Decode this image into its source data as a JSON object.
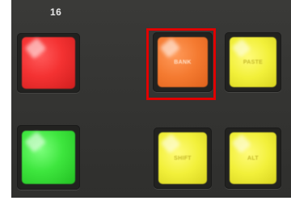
{
  "panel": {
    "channel_number": "16"
  },
  "keys": {
    "bank": {
      "label": "BANK",
      "color": "#f47a30"
    },
    "paste": {
      "label": "PASTE",
      "color": "#f2f03a"
    },
    "shift": {
      "label": "SHIFT",
      "color": "#f2f03a"
    },
    "alt": {
      "label": "ALT",
      "color": "#f2f03a"
    },
    "red": {
      "color": "#f43232"
    },
    "green": {
      "color": "#3ee63e"
    }
  },
  "highlight": {
    "color": "#e00000",
    "target": "bank-key"
  }
}
